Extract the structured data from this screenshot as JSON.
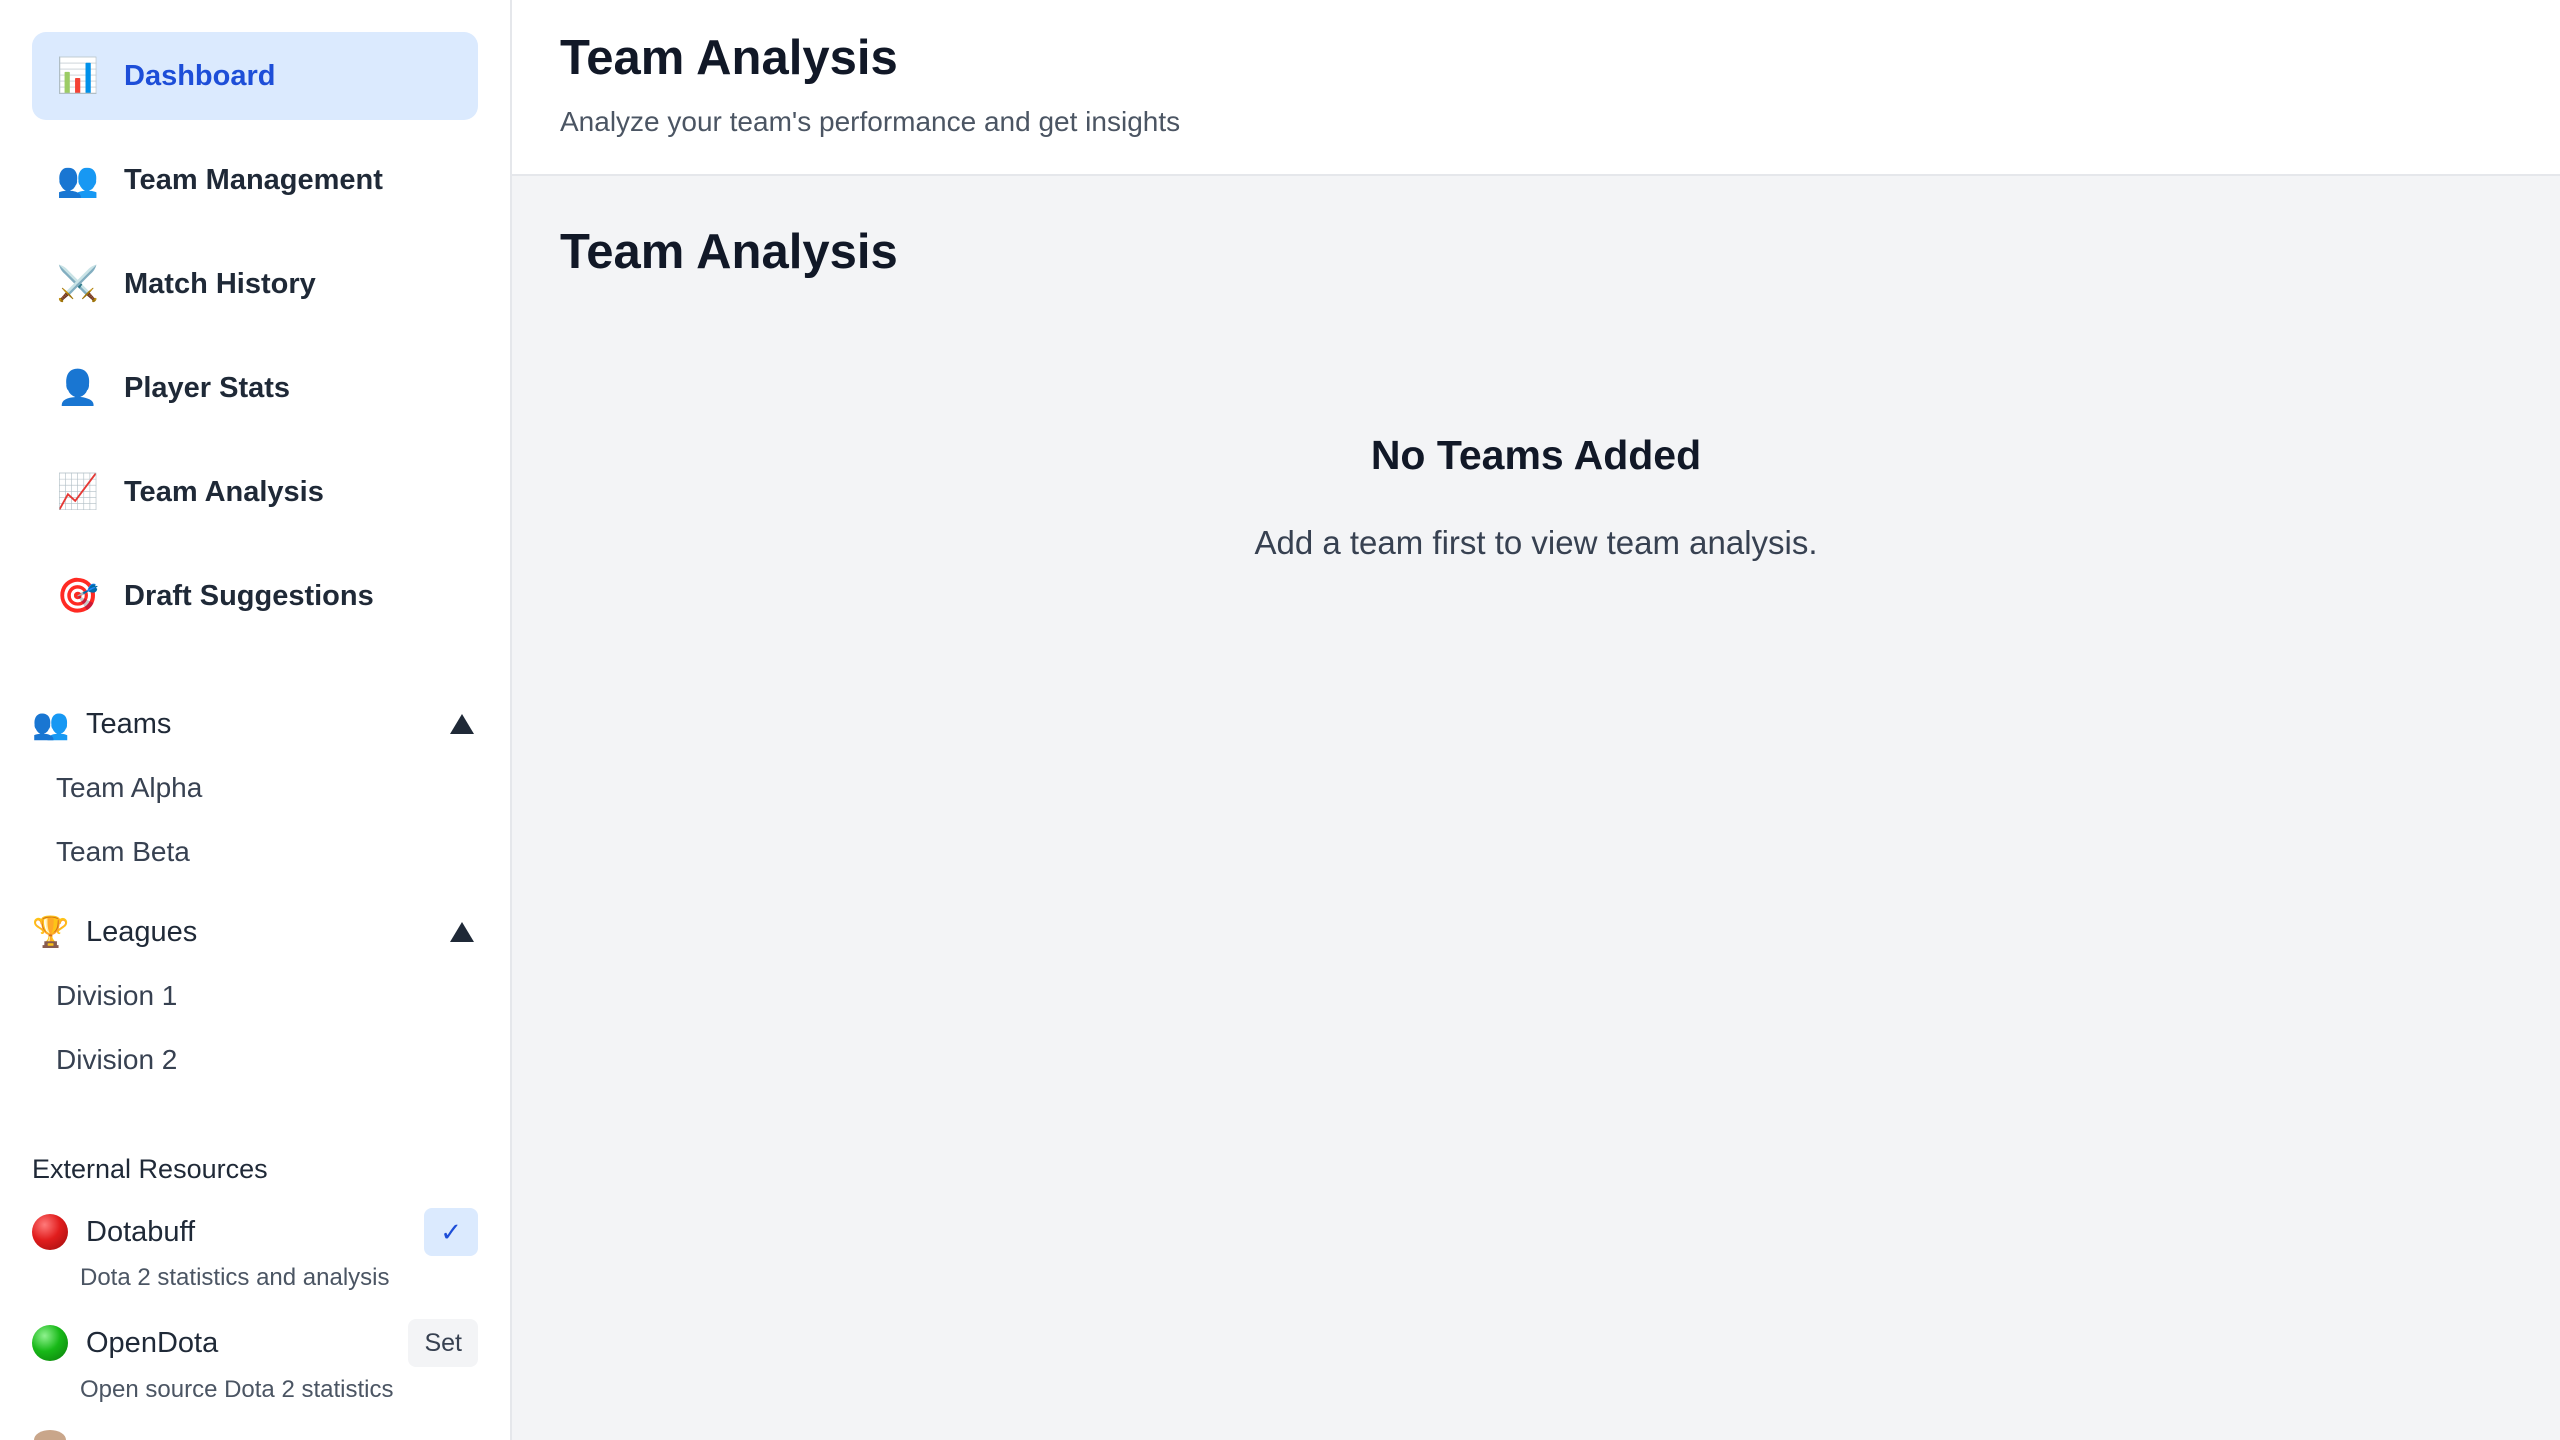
{
  "sidebar": {
    "nav": [
      {
        "label": "Dashboard",
        "icon": "bar-chart-icon",
        "active": true
      },
      {
        "label": "Team Management",
        "icon": "people-icon"
      },
      {
        "label": "Match History",
        "icon": "crossed-swords-icon"
      },
      {
        "label": "Player Stats",
        "icon": "person-icon"
      },
      {
        "label": "Team Analysis",
        "icon": "trending-chart-icon"
      },
      {
        "label": "Draft Suggestions",
        "icon": "target-icon"
      }
    ],
    "teams": {
      "label": "Teams",
      "icon": "people-icon",
      "items": [
        "Team Alpha",
        "Team Beta"
      ]
    },
    "leagues": {
      "label": "Leagues",
      "icon": "trophy-icon",
      "items": [
        "Division 1",
        "Division 2"
      ]
    },
    "external": {
      "title": "External Resources",
      "items": [
        {
          "name": "Dotabuff",
          "description": "Dota 2 statistics and analysis",
          "status": "✓",
          "color": "#e11d1d"
        },
        {
          "name": "OpenDota",
          "description": "Open source Dota 2 statistics",
          "status": "Set",
          "color": "#18b918"
        }
      ]
    }
  },
  "header": {
    "title": "Team Analysis",
    "subtitle": "Analyze your team's performance and get insights"
  },
  "main": {
    "title": "Team Analysis",
    "empty_title": "No Teams Added",
    "empty_message": "Add a team first to view team analysis."
  },
  "colors": {
    "accent": "#1d4ed8",
    "active_bg": "#dbeafe",
    "page_bg": "#f3f4f6"
  }
}
